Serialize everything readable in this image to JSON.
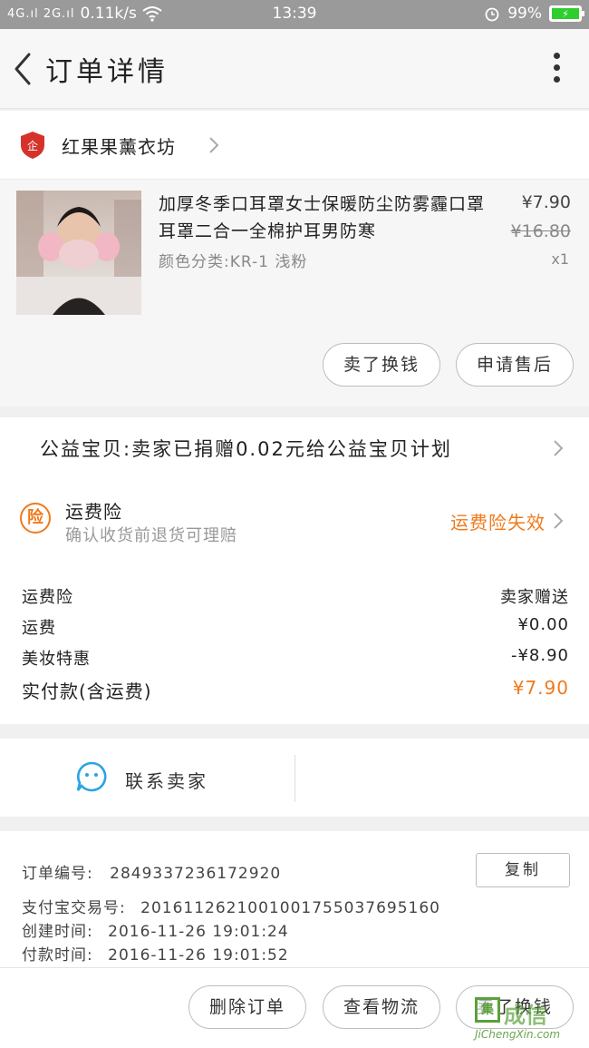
{
  "status_bar": {
    "signal": "4G.ıl 2G.ıl",
    "speed": "0.11k/s",
    "time": "13:39",
    "battery": "99%"
  },
  "nav": {
    "title": "订单详情"
  },
  "shop": {
    "name": "红果果薰衣坊",
    "logo_text": "企"
  },
  "product": {
    "title": "加厚冬季口耳罩女士保暖防尘防雾霾口罩耳罩二合一全棉护耳男防寒",
    "spec": "颜色分类:KR-1 浅粉",
    "price": "¥7.90",
    "original_price": "¥16.80",
    "quantity": "x1",
    "actions": [
      "卖了换钱",
      "申请售后"
    ]
  },
  "charity": {
    "text": "公益宝贝:卖家已捐赠0.02元给公益宝贝计划"
  },
  "insurance": {
    "icon_text": "险",
    "title": "运费险",
    "subtitle": "确认收货前退货可理赔",
    "status": "运费险失效"
  },
  "costs": [
    {
      "label": "运费险",
      "value": "卖家赠送"
    },
    {
      "label": "运费",
      "value": "¥0.00"
    },
    {
      "label": "美妆特惠",
      "value": "-¥8.90"
    },
    {
      "label": "实付款(含运费)",
      "value": "¥7.90"
    }
  ],
  "contact": {
    "label": "联系卖家"
  },
  "meta": {
    "order_no_label": "订单编号:",
    "order_no": "2849337236172920",
    "alipay_label": "支付宝交易号:",
    "alipay_no": "2016112621001001755037695160",
    "created_label": "创建时间:",
    "created": "2016-11-26 19:01:24",
    "paid_label": "付款时间:",
    "paid": "2016-11-26 19:01:52",
    "copy_label": "复制"
  },
  "bottom_actions": [
    "删除订单",
    "查看物流",
    "卖了换钱"
  ],
  "watermark": {
    "logo": "集",
    "text": "成信",
    "url": "JiChengXin.com"
  },
  "colors": {
    "accent": "#f07a1c",
    "shop_logo": "#d6322c",
    "contact_icon": "#29a3e6",
    "battery": "#2fce2f"
  }
}
